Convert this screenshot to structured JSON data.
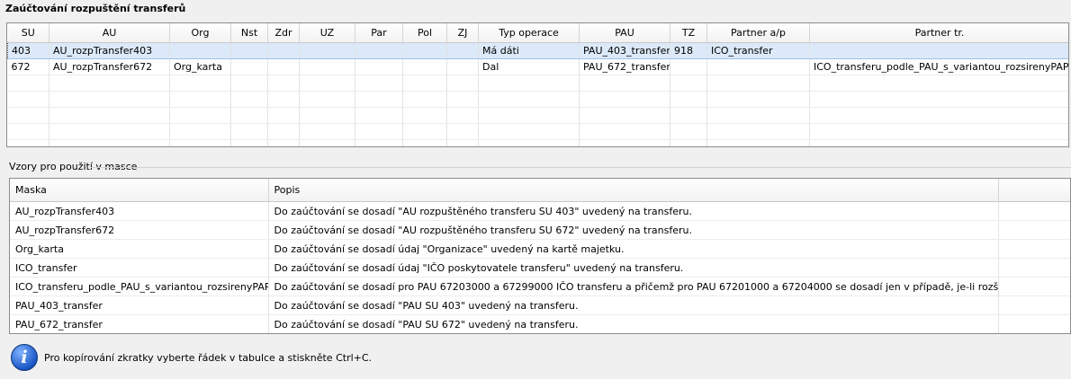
{
  "transfers": {
    "title": "Zaúčtování rozpuštění transferů",
    "columns": [
      "SU",
      "AU",
      "Org",
      "Nst",
      "Zdr",
      "UZ",
      "Par",
      "Pol",
      "ZJ",
      "Typ operace",
      "PAU",
      "TZ",
      "Partner a/p",
      "Partner tr."
    ],
    "rows": [
      {
        "SU": "403",
        "AU": "AU_rozpTransfer403",
        "Org": "",
        "Nst": "",
        "Zdr": "",
        "UZ": "",
        "Par": "",
        "Pol": "",
        "ZJ": "",
        "Typ": "Má dáti",
        "PAU": "PAU_403_transfer",
        "TZ": "918",
        "PartnerAP": "ICO_transfer",
        "PartnerTr": ""
      },
      {
        "SU": "672",
        "AU": "AU_rozpTransfer672",
        "Org": "Org_karta",
        "Nst": "",
        "Zdr": "",
        "UZ": "",
        "Par": "",
        "Pol": "",
        "ZJ": "",
        "Typ": "Dal",
        "PAU": "PAU_672_transfer",
        "TZ": "",
        "PartnerAP": "",
        "PartnerTr": "ICO_transferu_podle_PAU_s_variantou_rozsirenyPAP"
      }
    ]
  },
  "masks": {
    "section_title": "Vzory pro použití v masce",
    "columns": [
      "Maska",
      "Popis"
    ],
    "rows": [
      {
        "mask": "AU_rozpTransfer403",
        "desc": "Do zaúčtování se dosadí \"AU rozpuštěného transferu SU 403\" uvedený na transferu."
      },
      {
        "mask": "AU_rozpTransfer672",
        "desc": "Do zaúčtování se dosadí \"AU rozpuštěného transferu SU 672\" uvedený na transferu."
      },
      {
        "mask": "Org_karta",
        "desc": "Do zaúčtování se dosadí údaj \"Organizace\" uvedený na kartě majetku."
      },
      {
        "mask": "ICO_transfer",
        "desc": "Do zaúčtování se dosadí údaj \"IČO poskytovatele transferu\" uvedený na transferu."
      },
      {
        "mask": "ICO_transferu_podle_PAU_s_variantou_rozsirenyPAP",
        "desc": "Do zaúčtování se dosadí pro PAU 67203000 a 67299000 IČO transferu a přičemž pro PAU 67201000 a 67204000 se dosadí jen v případě, je-li rozšířený PAP."
      },
      {
        "mask": "PAU_403_transfer",
        "desc": "Do zaúčtování se dosadí \"PAU SU 403\" uvedený na transferu."
      },
      {
        "mask": "PAU_672_transfer",
        "desc": "Do zaúčtování se dosadí \"PAU SU 672\" uvedený na transferu."
      }
    ]
  },
  "info": {
    "icon": "info-icon",
    "text": "Pro kopírování zkratky vyberte řádek v tabulce a stiskněte Ctrl+C."
  }
}
